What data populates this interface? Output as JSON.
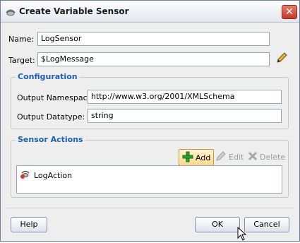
{
  "window": {
    "title": "Create Variable Sensor",
    "close_glyph": "✕"
  },
  "form": {
    "name_label": "Name:",
    "name_value": "LogSensor",
    "target_label": "Target:",
    "target_value": "$LogMessage"
  },
  "configuration": {
    "title": "Configuration",
    "namespace_label": "Output Namespace:",
    "namespace_value": "http://www.w3.org/2001/XMLSchema",
    "datatype_label": "Output Datatype:",
    "datatype_value": "string"
  },
  "sensor_actions": {
    "title": "Sensor Actions",
    "add_label": "Add",
    "edit_label": "Edit",
    "delete_label": "Delete",
    "items": [
      {
        "label": "LogAction"
      }
    ]
  },
  "footer": {
    "help_label": "Help",
    "ok_label": "OK",
    "cancel_label": "Cancel"
  },
  "icons": {
    "title": "sensor-icon",
    "target_edit": "pencil-icon",
    "add": "plus-icon",
    "edit": "pencil-icon",
    "delete": "x-icon",
    "action": "log-action-icon"
  },
  "colors": {
    "group_title": "#1d5eb7",
    "close_button": "#c8392c"
  }
}
